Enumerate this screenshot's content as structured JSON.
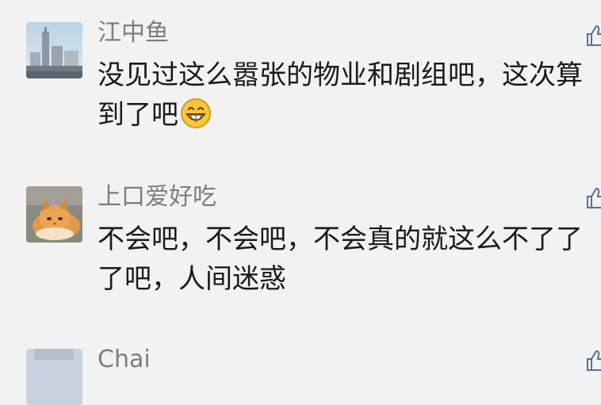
{
  "comments": [
    {
      "username": "江中鱼",
      "lines": [
        "没见过这么嚣张的物业和剧组吧，这次算",
        "到了吧"
      ],
      "emoji": "grinning-face-emoji"
    },
    {
      "username": "上口爱好吃",
      "lines": [
        "不会吧，不会吧，不会真的就这么不了了",
        "了吧，人间迷惑"
      ]
    },
    {
      "username": "Chai"
    }
  ],
  "icons": {
    "like": "thumbs-up-icon"
  },
  "colors": {
    "background": "#f2f2f2",
    "username": "#7d7d7d",
    "text": "#1a1a1a",
    "icon": "#5a6f94"
  }
}
